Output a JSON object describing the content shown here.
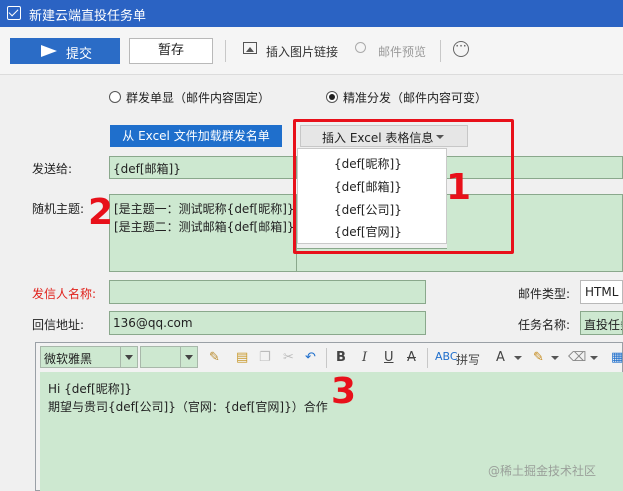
{
  "window": {
    "title": "新建云端直投任务单"
  },
  "toolbar": {
    "submit_label": "提交",
    "draft_label": "暂存",
    "insert_image_label": "插入图片链接",
    "preview_label": "邮件预览"
  },
  "mode": {
    "option1": "群发单显（邮件内容固定）",
    "option2": "精准分发（邮件内容可变）",
    "selected": "option2"
  },
  "actions": {
    "load_excel_label": "从 Excel 文件加载群发名单",
    "insert_excel_label": "插入 Excel 表格信息"
  },
  "excel_menu": {
    "items": [
      "{def[昵称]}",
      "{def[邮箱]}",
      "{def[公司]}",
      "{def[官网]}"
    ]
  },
  "form": {
    "to_label": "发送给:",
    "to_value": "{def[邮箱]}",
    "subject_label": "随机主题:",
    "subject_line1": "[是主题一：测试昵称{def[昵称]}",
    "subject_line2": "[是主题二：测试邮箱{def[邮箱]}",
    "sender_label": "发信人名称:",
    "sender_value": "",
    "mail_type_label": "邮件类型:",
    "mail_type_value": "HTML",
    "reply_label": "回信地址:",
    "reply_value": "136@qq.com",
    "task_label": "任务名称:",
    "task_value": "直投任务"
  },
  "editor": {
    "font_name": "微软雅黑",
    "font_size": "",
    "spell_label": "拼写",
    "body_line1": "Hi {def[昵称]}",
    "body_line2": "期望与贵司{def[公司]}（官网：{def[官网]}）合作"
  },
  "annotations": {
    "n1": "1",
    "n2": "2",
    "n3": "3"
  },
  "watermark": "@稀土掘金技术社区",
  "colors": {
    "accent": "#2b6cc6",
    "highlight_box": "#e8101a",
    "field_bg": "#cde8d0"
  }
}
